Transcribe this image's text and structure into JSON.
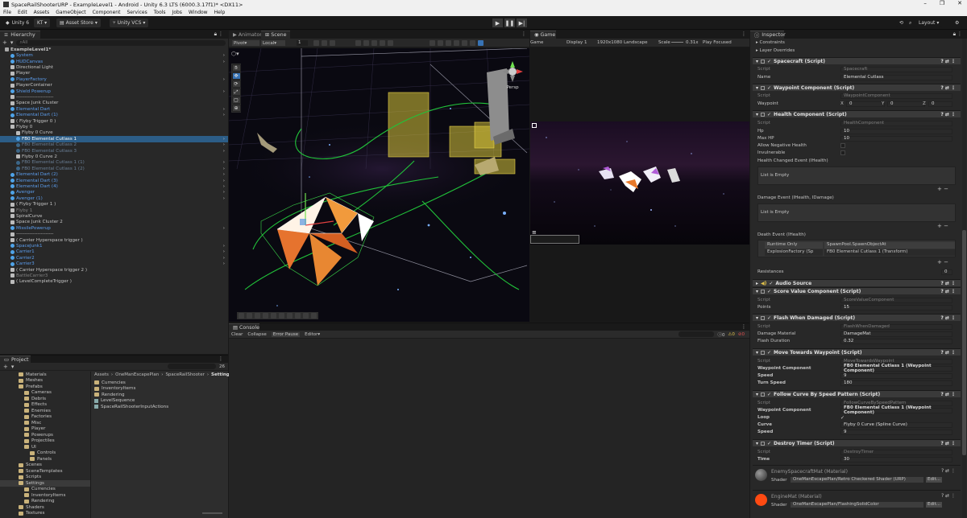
{
  "window": {
    "title": "SpaceRailShooterURP - ExampleLevel1 - Android - Unity 6.3 LTS (6000.3.17f1)* <DX11>"
  },
  "menu": [
    "File",
    "Edit",
    "Assets",
    "GameObject",
    "Component",
    "Services",
    "Tools",
    "Jobs",
    "Window",
    "Help"
  ],
  "toolbar": {
    "unity_label": "Unity 6",
    "account": "KT",
    "asset_store": "Asset Store",
    "vcs": "Unity VCS",
    "layout": "Layout",
    "play": "▶",
    "pause": "❚❚",
    "step": "▶|"
  },
  "hierarchy": {
    "tab": "Hierarchy",
    "search_placeholder": "All",
    "items": [
      {
        "label": "ExampleLevel1*",
        "depth": 0,
        "style": "scene"
      },
      {
        "label": "System",
        "depth": 1,
        "style": "blue"
      },
      {
        "label": "HUDCanvas",
        "depth": 1,
        "style": "blue"
      },
      {
        "label": "Directional Light",
        "depth": 1,
        "style": "white"
      },
      {
        "label": "Player",
        "depth": 1,
        "style": "white"
      },
      {
        "label": "PlayerFactory",
        "depth": 1,
        "style": "blue"
      },
      {
        "label": "PlayerContainer",
        "depth": 1,
        "style": "white"
      },
      {
        "label": "Shield Powerup",
        "depth": 1,
        "style": "blue"
      },
      {
        "label": "-----------------------",
        "depth": 1,
        "style": "white"
      },
      {
        "label": "Space Junk Cluster",
        "depth": 1,
        "style": "white"
      },
      {
        "label": "Elemental Dart",
        "depth": 1,
        "style": "blue"
      },
      {
        "label": "Elemental Dart (1)",
        "depth": 1,
        "style": "blue"
      },
      {
        "label": "( Flyby Trigger 0 )",
        "depth": 1,
        "style": "white"
      },
      {
        "label": "Flyby 0",
        "depth": 1,
        "style": "white"
      },
      {
        "label": "Flyby 0 Curve",
        "depth": 2,
        "style": "white"
      },
      {
        "label": "FB0 Elemental Cutlass 1",
        "depth": 2,
        "style": "selected"
      },
      {
        "label": "FB0 Elemental Cutlass 2",
        "depth": 2,
        "style": "dim"
      },
      {
        "label": "FB0 Elemental Cutlass 3",
        "depth": 2,
        "style": "dim"
      },
      {
        "label": "Flyby 0 Curve 2",
        "depth": 2,
        "style": "white"
      },
      {
        "label": "FB0 Elemental Cutlass 1 (1)",
        "depth": 2,
        "style": "dim"
      },
      {
        "label": "FB0 Elemental Cutlass 1 (2)",
        "depth": 2,
        "style": "dim"
      },
      {
        "label": "Elemental Dart (2)",
        "depth": 1,
        "style": "blue"
      },
      {
        "label": "Elemental Dart (3)",
        "depth": 1,
        "style": "blue"
      },
      {
        "label": "Elemental Dart (4)",
        "depth": 1,
        "style": "blue"
      },
      {
        "label": "Avenger",
        "depth": 1,
        "style": "blue"
      },
      {
        "label": "Avenger (1)",
        "depth": 1,
        "style": "blue"
      },
      {
        "label": "( Flyby Trigger 1 )",
        "depth": 1,
        "style": "white"
      },
      {
        "label": "Flyby 1",
        "depth": 1,
        "style": "gray"
      },
      {
        "label": "SpiralCurve",
        "depth": 1,
        "style": "white"
      },
      {
        "label": "Space Junk Cluster 2",
        "depth": 1,
        "style": "white"
      },
      {
        "label": "MissilePowerup",
        "depth": 1,
        "style": "blue"
      },
      {
        "label": "-----------------------",
        "depth": 1,
        "style": "white"
      },
      {
        "label": "( Carrier Hyperspace trigger )",
        "depth": 1,
        "style": "white"
      },
      {
        "label": "SpaceJunk1",
        "depth": 1,
        "style": "blue"
      },
      {
        "label": "Carrier1",
        "depth": 1,
        "style": "blue"
      },
      {
        "label": "Carrier2",
        "depth": 1,
        "style": "blue"
      },
      {
        "label": "Carrier3",
        "depth": 1,
        "style": "blue"
      },
      {
        "label": "( Carrier Hyperspace trigger 2 )",
        "depth": 1,
        "style": "white"
      },
      {
        "label": "BattleCarrier3",
        "depth": 1,
        "style": "gray"
      },
      {
        "label": "( LevelCompleteTrigger )",
        "depth": 1,
        "style": "white"
      }
    ]
  },
  "project": {
    "tab": "Project",
    "search_count": "26",
    "breadcrumb": [
      "Assets",
      "OneManEscapePlan",
      "SpaceRailShooter",
      "Settings"
    ],
    "tree": [
      {
        "label": "Materials",
        "depth": 1
      },
      {
        "label": "Meshes",
        "depth": 1
      },
      {
        "label": "Prefabs",
        "depth": 1
      },
      {
        "label": "Cameras",
        "depth": 2
      },
      {
        "label": "Debris",
        "depth": 2
      },
      {
        "label": "Effects",
        "depth": 2
      },
      {
        "label": "Enemies",
        "depth": 2
      },
      {
        "label": "Factories",
        "depth": 2
      },
      {
        "label": "Misc",
        "depth": 2
      },
      {
        "label": "Player",
        "depth": 2
      },
      {
        "label": "Powerups",
        "depth": 2
      },
      {
        "label": "Projectiles",
        "depth": 2
      },
      {
        "label": "UI",
        "depth": 2
      },
      {
        "label": "Controls",
        "depth": 3
      },
      {
        "label": "Panels",
        "depth": 3
      },
      {
        "label": "Scenes",
        "depth": 1
      },
      {
        "label": "SceneTemplates",
        "depth": 1
      },
      {
        "label": "Scripts",
        "depth": 1
      },
      {
        "label": "Settings",
        "depth": 1
      },
      {
        "label": "Currencies",
        "depth": 2
      },
      {
        "label": "InventoryItems",
        "depth": 2
      },
      {
        "label": "Rendering",
        "depth": 2
      },
      {
        "label": "Shaders",
        "depth": 1
      },
      {
        "label": "Textures",
        "depth": 1
      }
    ],
    "files": [
      "Currencies",
      "InventoryItems",
      "Rendering",
      "LevelSequence",
      "SpaceRailShooterInputActions"
    ]
  },
  "scene": {
    "tabs": [
      "Animator",
      "Scene"
    ],
    "pivot": "Pivot",
    "local": "Local",
    "snap": "1",
    "persp": "Persp"
  },
  "game": {
    "tab": "Game",
    "mode": "Game",
    "display": "Display 1",
    "resolution": "1920x1080 Landscape",
    "scale_label": "Scale",
    "scale": "0.31x",
    "play_focused": "Play Focused"
  },
  "console": {
    "tab": "Console",
    "buttons": [
      "Clear",
      "Collapse",
      "Error Pause",
      "Editor"
    ],
    "counts": [
      "0",
      "0",
      "0"
    ]
  },
  "inspector": {
    "tab": "Inspector",
    "constraints": "Constraints",
    "layer_overrides": "Layer Overrides",
    "spacecraft": {
      "title": "Spacecraft (Script)",
      "script_label": "Script",
      "script": "Spacecraft",
      "name_label": "Name",
      "name": "Elemental Cutlass"
    },
    "waypoint": {
      "title": "Waypoint Component (Script)",
      "script_label": "Script",
      "script": "WaypointComponent",
      "wp_label": "Waypoint",
      "x_label": "X",
      "x": "0",
      "y_label": "Y",
      "y": "0",
      "z_label": "Z",
      "z": "0"
    },
    "health": {
      "title": "Health Component (Script)",
      "script_label": "Script",
      "script": "HealthComponent",
      "hp_label": "Hp",
      "hp": "10",
      "maxhp_label": "Max HP",
      "maxhp": "10",
      "neg_label": "Allow Negative Health",
      "inv_label": "Invulnerable",
      "changed_event": "Health Changed Event (IHealth)",
      "list_empty": "List is Empty",
      "damage_event": "Damage Event (IHealth, IDamage)",
      "list_empty2": "List is Empty",
      "death_event": "Death Event (IHealth)",
      "runtime": "Runtime Only",
      "method": "SpawnPool.SpawnObjectAt",
      "target": "ExplosionFactory (Sp",
      "arg": "FB0 Elemental Cutlass 1 (Transform)"
    },
    "resistances": {
      "label": "Resistances",
      "value": "0"
    },
    "audio": {
      "title": "Audio Source"
    },
    "score": {
      "title": "Score Value Component (Script)",
      "script_label": "Script",
      "script": "ScoreValueComponent",
      "points_label": "Points",
      "points": "15"
    },
    "flash": {
      "title": "Flash When Damaged (Script)",
      "script_label": "Script",
      "script": "FlashWhenDamaged",
      "mat_label": "Damage Material",
      "mat": "DamageMat",
      "dur_label": "Flash Duration",
      "dur": "0.32"
    },
    "move": {
      "title": "Move Towards Waypoint (Script)",
      "script_label": "Script",
      "script": "MoveTowardsWaypoint",
      "wpc_label": "Waypoint Component",
      "wpc": "FB0 Elemental Cutlass 1 (Waypoint Component)",
      "speed_label": "Speed",
      "speed": "9",
      "turn_label": "Turn Speed",
      "turn": "180"
    },
    "follow": {
      "title": "Follow Curve By Speed Pattern (Script)",
      "script_label": "Script",
      "script": "FollowCurveBySpeedPattern",
      "wpc_label": "Waypoint Component",
      "wpc": "FB0 Elemental Cutlass 1 (Waypoint Component)",
      "loop_label": "Loop",
      "curve_label": "Curve",
      "curve": "Flyby 0 Curve (Spline Curve)",
      "speed_label": "Speed",
      "speed": "9"
    },
    "destroy": {
      "title": "Destroy Timer (Script)",
      "script_label": "Script",
      "script": "DestroyTimer",
      "time_label": "Time",
      "time": "30"
    },
    "mat1": {
      "title": "EnemySpacecraftMat (Material)",
      "shader_label": "Shader",
      "shader": "OneManEscapePlan/Retro Checkered Shader (URP)",
      "edit": "Edit..."
    },
    "mat2": {
      "title": "EngineMat (Material)",
      "shader_label": "Shader",
      "shader": "OneManEscapePlan/FlashingSolidColor",
      "edit": "Edit..."
    }
  },
  "colors": {
    "accent": "#2c5d87",
    "prefab_blue": "#5c9ded",
    "scene_bg": "#0b0a12",
    "game_bg": "#160d1c",
    "engine_orange": "#ff4a12"
  }
}
